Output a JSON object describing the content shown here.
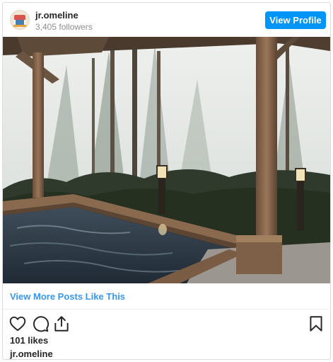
{
  "post": {
    "username": "jr.omeline",
    "followers": "3,405 followers",
    "view_profile_label": "View Profile",
    "more_posts_label": "View More Posts Like This",
    "likes": "101 likes",
    "caption_username": "jr.omeline"
  },
  "icons": {
    "like": "heart-icon",
    "comment": "comment-icon",
    "share": "share-icon",
    "save": "bookmark-icon"
  },
  "colors": {
    "accent": "#0095f6",
    "link": "#3897f0",
    "text": "#262626",
    "muted": "#8e8e8e"
  }
}
